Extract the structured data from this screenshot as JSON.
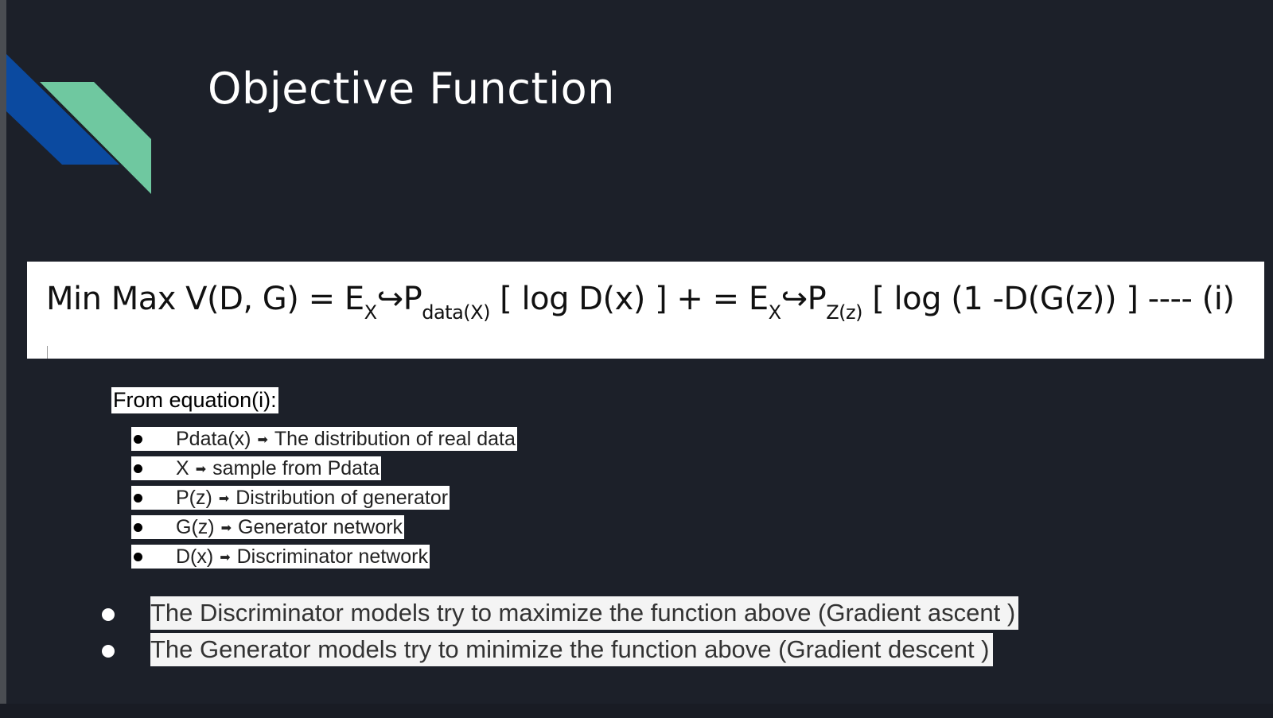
{
  "slide": {
    "title": "Objective Function",
    "equation": {
      "part1": "Min Max V(D, G) = E",
      "sub1": "X",
      "part2": "↪P",
      "sub2": "data(X)",
      "part3": " [ log D(x) ] +  = E",
      "sub3": "X",
      "part4": "↪P",
      "sub4": "Z(z)",
      "part5": " [ log (1 -D(G(z)) ]  ---- (i)"
    },
    "from_label": "From equation(i):",
    "definitions": [
      {
        "term": "Pdata(x)",
        "arrow": "➡",
        "desc": "The distribution of real data"
      },
      {
        "term": "X",
        "arrow": "➡",
        "desc": "sample from Pdata"
      },
      {
        "term": "P(z)",
        "arrow": "➡",
        "desc": "Distribution of generator"
      },
      {
        "term": "G(z)",
        "arrow": "➡",
        "desc": "Generator network"
      },
      {
        "term": "D(x)",
        "arrow": "➡",
        "desc": "Discriminator network"
      }
    ],
    "points": [
      "The Discriminator models try to maximize the function above (Gradient ascent )",
      "The Generator models try to minimize the function above (Gradient descent )"
    ],
    "colors": {
      "background": "#1c2029",
      "accent_blue": "#0b4aa0",
      "accent_green": "#6fc8a0"
    }
  }
}
